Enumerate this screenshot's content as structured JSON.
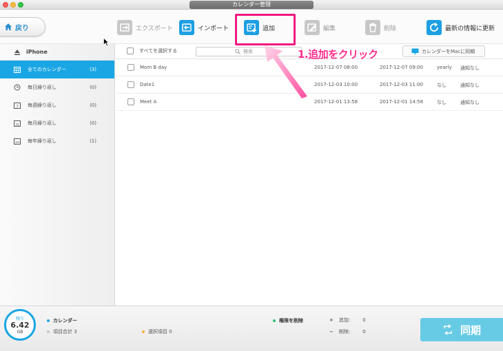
{
  "window": {
    "title": "カレンダー管理"
  },
  "toolbar": {
    "back_label": "戻り",
    "export_label": "エクスポート",
    "import_label": "インポート",
    "add_label": "追加",
    "edit_label": "編集",
    "delete_label": "削除",
    "refresh_label": "最新の情報に更新"
  },
  "sidebar": {
    "device": "iPhone",
    "items": [
      {
        "label": "全てのカレンダー",
        "count": "(3)",
        "icon": "calendar-grid-icon"
      },
      {
        "label": "毎日繰り返し",
        "count": "(0)",
        "icon": "daily-repeat-icon"
      },
      {
        "label": "毎週繰り返し",
        "count": "(0)",
        "icon": "weekly-7-icon"
      },
      {
        "label": "毎月繰り返し",
        "count": "(0)",
        "icon": "monthly-31-icon"
      },
      {
        "label": "毎年繰り返し",
        "count": "(1)",
        "icon": "yearly-365-icon"
      }
    ]
  },
  "list": {
    "select_all_label": "すべてを選択する",
    "search_placeholder": "検索",
    "sync_mac_label": "カレンダーをMacに同期",
    "rows": [
      {
        "name": "Mom  B day",
        "start": "2017-12-07 08:00",
        "end": "2017-12-07 09:00",
        "repeat": "yearly",
        "alert": "通知なし"
      },
      {
        "name": "Date1",
        "start": "2017-12-03 10:00",
        "end": "2017-12-03 11:00",
        "repeat": "なし",
        "alert": "通知なし"
      },
      {
        "name": "Meet A",
        "start": "2017-12-01 13:58",
        "end": "2017-12-01 14:58",
        "repeat": "なし",
        "alert": "通知なし"
      }
    ]
  },
  "annotation": {
    "text": "1.追加をクリック",
    "color": "#ff2d8c"
  },
  "footer": {
    "storage_label": "残り",
    "storage_value": "6.42",
    "storage_unit": "GB",
    "category_label": "カレンダー",
    "total_label": "項目合計 3",
    "selected_label": "選択項目 0",
    "delete_perm_label": "権限を削除",
    "add_label": "追加:",
    "add_value": "0",
    "remove_label": "削除:",
    "remove_value": "0",
    "sync_label": "同期"
  },
  "colors": {
    "accent": "#1aa6e4",
    "highlight": "#f0187f",
    "sync_button": "#67cbe6"
  }
}
